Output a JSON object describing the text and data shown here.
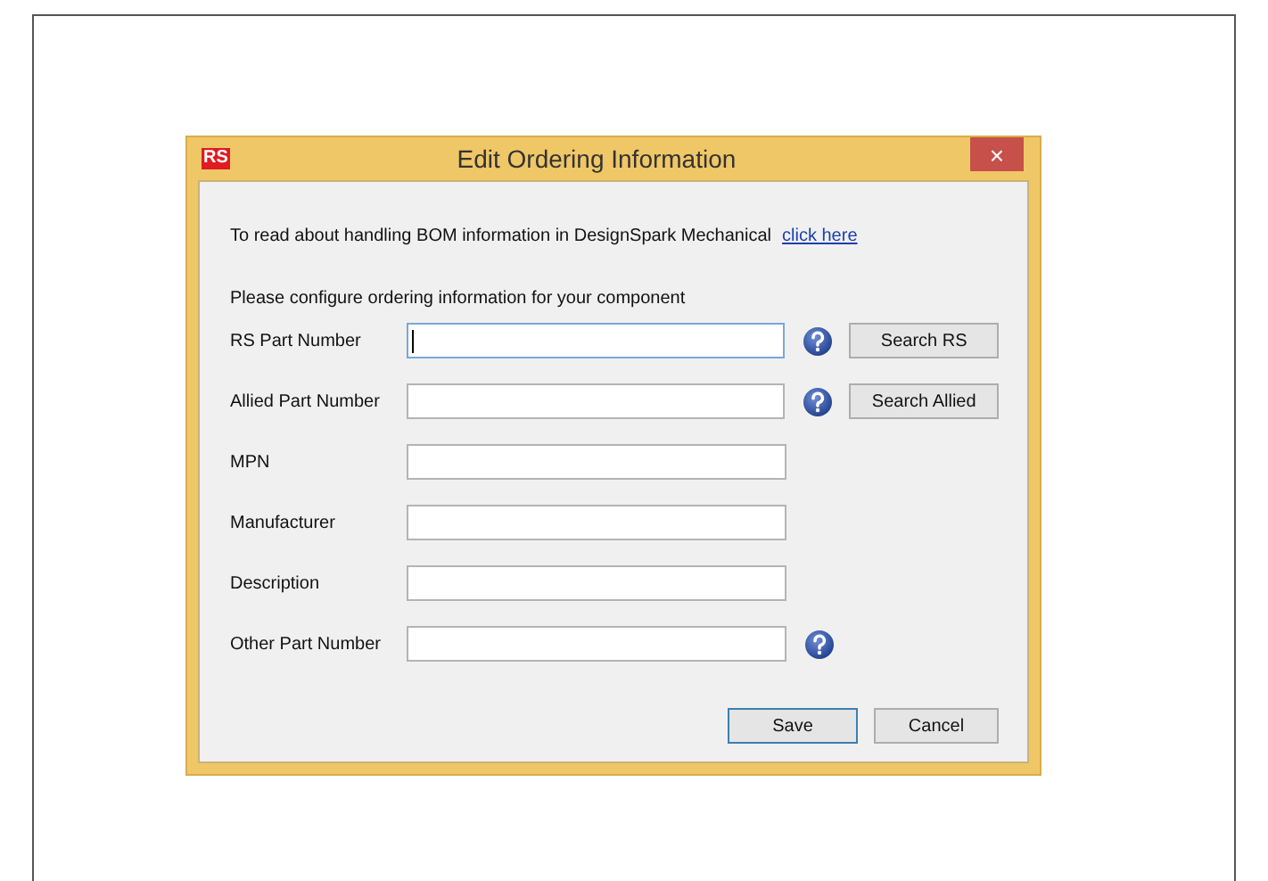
{
  "window": {
    "logo": "RS",
    "title": "Edit Ordering Information",
    "close": "×"
  },
  "intro": {
    "text": "To read about handling BOM information in DesignSpark Mechanical",
    "link": "click here"
  },
  "instruction": "Please configure ordering information for your component",
  "fields": [
    {
      "label": "RS Part Number",
      "focused": true,
      "help": true,
      "button": "Search RS"
    },
    {
      "label": "Allied Part Number",
      "focused": false,
      "help": true,
      "button": "Search Allied"
    },
    {
      "label": "MPN",
      "focused": false,
      "help": false
    },
    {
      "label": "Manufacturer",
      "focused": false,
      "help": false
    },
    {
      "label": "Description",
      "focused": false,
      "help": false
    },
    {
      "label": "Other Part Number",
      "focused": false,
      "help": true
    }
  ],
  "buttons": [
    {
      "label": "Save",
      "default": true
    },
    {
      "label": "Cancel",
      "default": false
    }
  ]
}
